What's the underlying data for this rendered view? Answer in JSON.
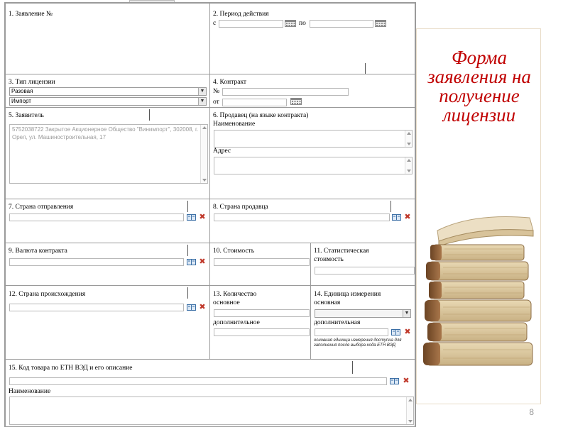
{
  "slide_title": "Форма заявления на получение лицензии",
  "page_number": "8",
  "form": {
    "f1_label": "1. Заявление №",
    "f2_label": "2. Период действия",
    "f2_from": "с",
    "f2_to": "по",
    "f3_label": "3. Тип лицензии",
    "f3_select1": "Разовая",
    "f3_select2": "Импорт",
    "f4_label": "4. Контракт",
    "f4_no": "№",
    "f4_from": "от",
    "f5_label": "5. Заявитель",
    "f5_value": "5752038722 Закрытое Акционерное Общество \"Винимпорт\", 302008, г. Орел, ул. Машиностроительная, 17",
    "f6_label": "6. Продавец (на языке контракта)",
    "f6_name": "Наименование",
    "f6_address": "Адрес",
    "f7_label": "7. Страна отправления",
    "f8_label": "8. Страна продавца",
    "f9_label": "9. Валюта контракта",
    "f10_label": "10. Стоимость",
    "f11_label1": "11. Статистическая",
    "f11_label2": "стоимость",
    "f12_label": "12. Страна происхождения",
    "f13_label1": "13. Количество",
    "f13_label2": "основное",
    "f13_additional": "дополнительное",
    "f14_label1": "14. Единица измерения",
    "f14_label2": "основная",
    "f14_additional": "дополнительная",
    "f14_note": "основная единица измерения доступна для заполнения после выбора кода ЕТН ВЭД",
    "f15_label": "15. Код товара по ЕТН ВЭД и его описание",
    "f15_name": "Наименование"
  },
  "icons": {
    "book": "book-icon",
    "delete": "delete-icon",
    "calendar": "calendar-icon",
    "arrow": "chevron-down-icon"
  },
  "colors": {
    "title": "#c00000",
    "delete": "#c0392b",
    "book": "#3a6ea5"
  }
}
